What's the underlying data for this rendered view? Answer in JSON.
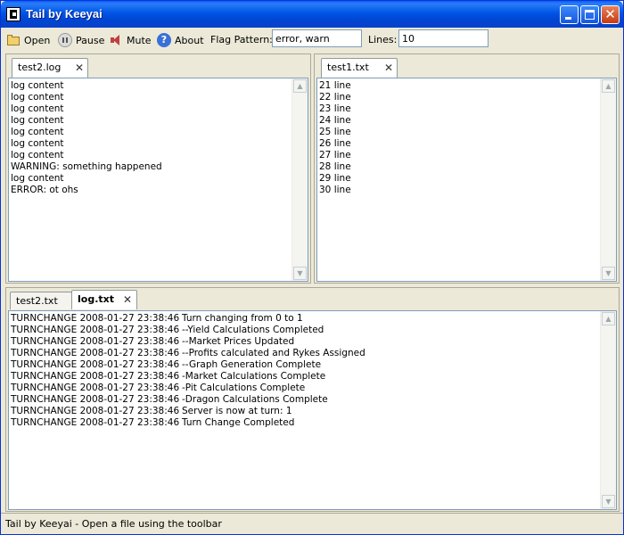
{
  "window": {
    "title": "Tail by Keeyai"
  },
  "toolbar": {
    "open": "Open",
    "pause": "Pause",
    "mute": "Mute",
    "about": "About",
    "flag_label": "Flag Pattern:",
    "flag_value": "error, warn",
    "lines_label": "Lines:",
    "lines_value": "10"
  },
  "top_left": {
    "tab_label": "test2.log",
    "lines": [
      "log content",
      "log content",
      "log content",
      "log content",
      "log content",
      "log content",
      "log content",
      "WARNING: something happened",
      "log content",
      "ERROR: ot ohs"
    ]
  },
  "top_right": {
    "tab_label": "test1.txt",
    "lines": [
      "21 line",
      "22 line",
      "23 line",
      "24 line",
      "25 line",
      "26 line",
      "27 line",
      "28 line",
      "29 line",
      "30 line"
    ]
  },
  "bottom": {
    "tabs": [
      {
        "label": "test2.txt"
      },
      {
        "label": "log.txt"
      }
    ],
    "rows": [
      {
        "source": "TURNCHANGE 2008-01-27 23:38:46",
        "message": "Turn changing from 0 to 1"
      },
      {
        "source": "TURNCHANGE 2008-01-27 23:38:46",
        "message": "--Yield Calculations Completed"
      },
      {
        "source": "TURNCHANGE 2008-01-27 23:38:46",
        "message": "--Market Prices Updated"
      },
      {
        "source": "TURNCHANGE 2008-01-27 23:38:46",
        "message": "--Profits calculated and Rykes Assigned"
      },
      {
        "source": "TURNCHANGE 2008-01-27 23:38:46",
        "message": "--Graph Generation Complete"
      },
      {
        "source": "TURNCHANGE 2008-01-27 23:38:46",
        "message": "-Market Calculations Complete"
      },
      {
        "source": "TURNCHANGE 2008-01-27 23:38:46",
        "message": "-Pit Calculations Complete"
      },
      {
        "source": "TURNCHANGE 2008-01-27 23:38:46",
        "message": "-Dragon Calculations Complete"
      },
      {
        "source": "TURNCHANGE 2008-01-27 23:38:46",
        "message": "Server is now at turn: 1"
      },
      {
        "source": "TURNCHANGE 2008-01-27 23:38:46",
        "message": "Turn Change Completed"
      }
    ]
  },
  "status": {
    "text": "Tail by Keeyai - Open a file using the toolbar"
  }
}
